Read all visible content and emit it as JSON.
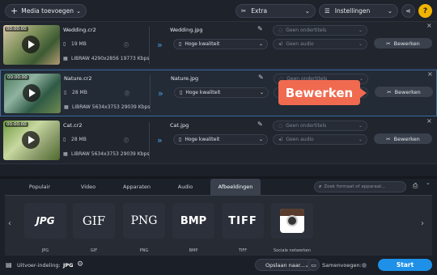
{
  "toolbar": {
    "add_media_label": "Media toevoegen",
    "extra_label": "Extra",
    "settings_label": "Instellingen"
  },
  "files": [
    {
      "duration": "00:00:00",
      "name": "Wedding.cr2",
      "size": "19 MB",
      "codec": "LIBRAW 4290x2856 19773 Kbps",
      "output_name": "Wedding.jpg",
      "quality": "Hoge kwaliteit",
      "subtitles": "Geen ondertitels",
      "audio": "Geen audio",
      "edit_label": "Bewerken"
    },
    {
      "duration": "00:00:00",
      "name": "Nature.cr2",
      "size": "28 MB",
      "codec": "LIBRAW 5634x3753 29039 Kbps",
      "output_name": "Nature.jpg",
      "quality": "Hoge kwaliteit",
      "subtitles": "Geen ondertitels",
      "audio": "Geen audio",
      "edit_label": "Bewerken"
    },
    {
      "duration": "00:00:00",
      "name": "Cat.cr2",
      "size": "28 MB",
      "codec": "LIBRAW 5634x3753 29039 Kbps",
      "output_name": "Cat.jpg",
      "quality": "Hoge kwaliteit",
      "subtitles": "Geen ondertitels",
      "audio": "Geen audio",
      "edit_label": "Bewerken"
    }
  ],
  "tooltip": {
    "label": "Bewerken",
    "color": "#f06a50"
  },
  "tabs": [
    "Populair",
    "Video",
    "Apparaten",
    "Audio",
    "Afbeeldingen"
  ],
  "active_tab": "Afbeeldingen",
  "search_placeholder": "Zoek formaat of apparaat...",
  "formats": [
    {
      "icon": "JPG",
      "label": "JPG"
    },
    {
      "icon": "GIF",
      "label": "GIF"
    },
    {
      "icon": "PNG",
      "label": "PNG"
    },
    {
      "icon": "BMP",
      "label": "BMP"
    },
    {
      "icon": "TIFF",
      "label": "TIFF"
    },
    {
      "icon": "instagram-icon",
      "label": "Sociale netwerken"
    }
  ],
  "bottom": {
    "output_label": "Uitvoer-indeling:",
    "output_value": "JPG",
    "save_label": "Opslaan naar...",
    "merge_label": "Samenvoegen:",
    "start_label": "Start"
  },
  "colors": {
    "accent": "#1e90e8",
    "tooltip": "#f06a50"
  }
}
